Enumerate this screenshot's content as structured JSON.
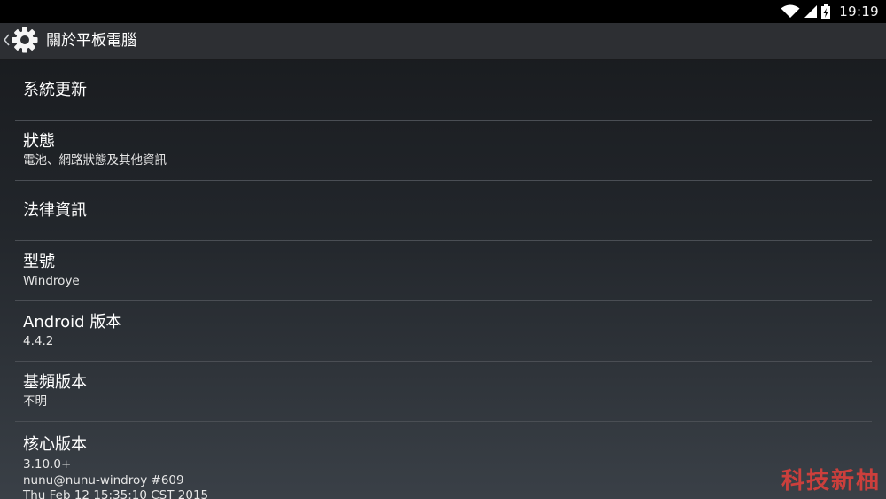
{
  "status_bar": {
    "time": "19:19",
    "icons": [
      "wifi-icon",
      "signal-icon",
      "battery-charging-icon"
    ]
  },
  "action_bar": {
    "title": "關於平板電腦",
    "icon": "gear-icon"
  },
  "settings": {
    "system_update": {
      "title": "系統更新"
    },
    "status": {
      "title": "狀態",
      "summary": "電池、網路狀態及其他資訊"
    },
    "legal": {
      "title": "法律資訊"
    },
    "model": {
      "title": "型號",
      "value": "Windroye"
    },
    "android_version": {
      "title": "Android 版本",
      "value": "4.4.2"
    },
    "baseband": {
      "title": "基頻版本",
      "value": "不明"
    },
    "kernel": {
      "title": "核心版本",
      "lines": [
        "3.10.0+",
        "nunu@nunu-windroy #609",
        "Thu Feb 12 15:35:10 CST 2015"
      ]
    }
  },
  "watermark": "科技新柚",
  "colors": {
    "watermark": "#d8403c",
    "status_bar": "#000000",
    "action_bar": "#2d2f33"
  }
}
